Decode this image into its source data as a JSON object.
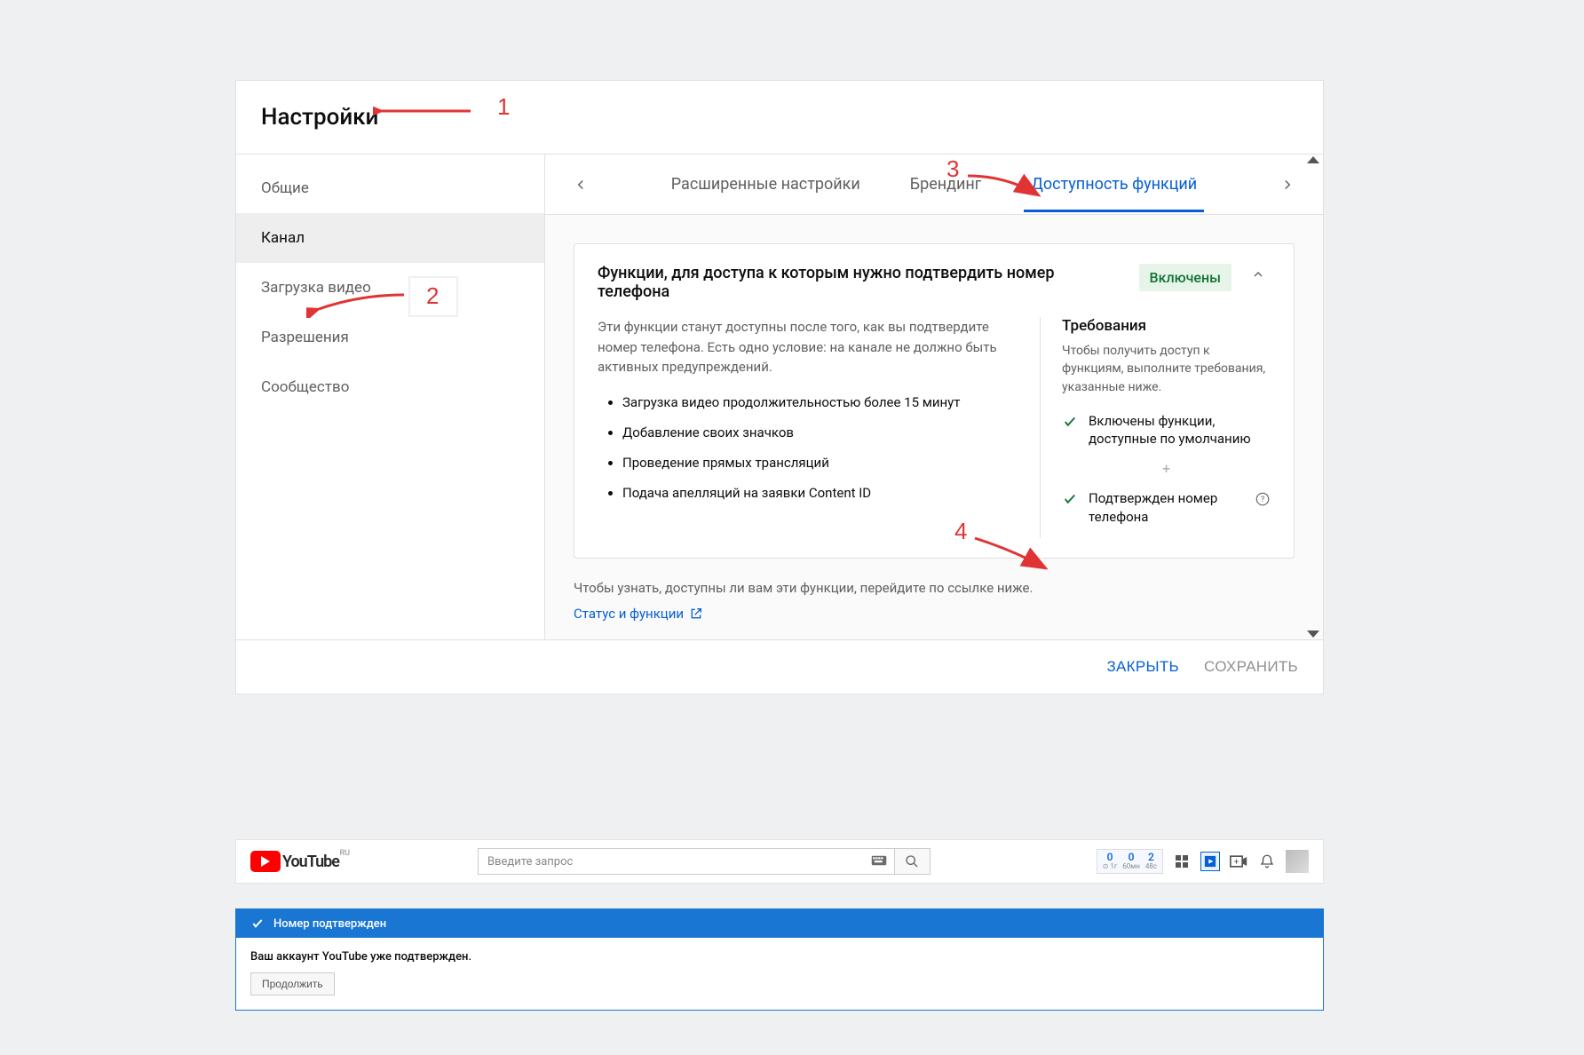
{
  "dialog": {
    "title": "Настройки",
    "sidebar": {
      "items": [
        {
          "label": "Общие",
          "active": false
        },
        {
          "label": "Канал",
          "active": true
        },
        {
          "label": "Загрузка видео",
          "active": false
        },
        {
          "label": "Разрешения",
          "active": false
        },
        {
          "label": "Сообщество",
          "active": false
        }
      ]
    },
    "tabs": [
      {
        "label": "Расширенные настройки",
        "active": false
      },
      {
        "label": "Брендинг",
        "active": false
      },
      {
        "label": "Доступность функций",
        "active": true
      }
    ],
    "panel": {
      "title": "Функции, для доступа к которым нужно подтвердить номер телефона",
      "status": "Включены",
      "description": "Эти функции станут доступны после того, как вы подтвердите номер телефона. Есть одно условие: на канале не должно быть активных предупреждений.",
      "bullets": [
        "Загрузка видео продолжительностью более 15 минут",
        "Добавление своих значков",
        "Проведение прямых трансляций",
        "Подача апелляций на заявки Content ID"
      ],
      "requirements": {
        "title": "Требования",
        "description": "Чтобы получить доступ к функциям, выполните требования, указанные ниже.",
        "items": [
          "Включены функции, доступные по умолчанию",
          "Подтвержден номер телефона"
        ]
      }
    },
    "footnote": "Чтобы узнать, доступны ли вам эти функции, перейдите по ссылке ниже.",
    "link_text": "Статус и функции",
    "footer": {
      "close": "ЗАКРЫТЬ",
      "save": "СОХРАНИТЬ"
    }
  },
  "annotations": {
    "n1": "1",
    "n2": "2",
    "n3": "3",
    "n4": "4"
  },
  "youtube_header": {
    "brand": "YouTube",
    "region": "RU",
    "search_placeholder": "Введите запрос",
    "timer": [
      {
        "val": "0",
        "lab": "⊙ 1г"
      },
      {
        "val": "0",
        "lab": "60мн"
      },
      {
        "val": "2",
        "lab": "48с"
      }
    ]
  },
  "confirm": {
    "banner_title": "Номер подтвержден",
    "body_text": "Ваш аккаунт YouTube уже подтвержден.",
    "button": "Продолжить"
  }
}
